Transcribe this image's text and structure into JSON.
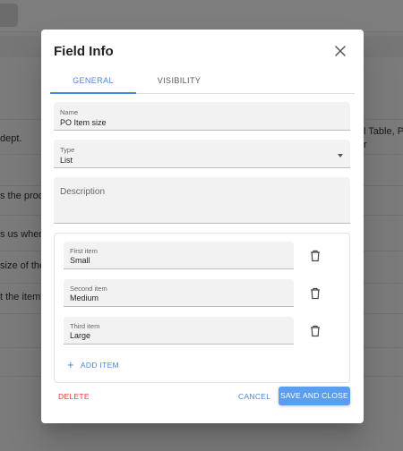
{
  "background": {
    "rows": [
      "dept.",
      "s the produ",
      "s us when",
      "size of the",
      "t the item'"
    ],
    "right_text_line1": "l Table, PO",
    "right_text_line2": "r"
  },
  "dialog": {
    "title": "Field Info",
    "close_icon": "close-icon",
    "tabs": [
      {
        "label": "GENERAL",
        "active": true
      },
      {
        "label": "VISIBILITY",
        "active": false
      }
    ],
    "name_field": {
      "label": "Name",
      "value": "PO Item size"
    },
    "type_field": {
      "label": "Type",
      "value": "List"
    },
    "description_field": {
      "placeholder": "Description"
    },
    "items": [
      {
        "label": "First item",
        "value": "Small"
      },
      {
        "label": "Second item",
        "value": "Medium"
      },
      {
        "label": "Third item",
        "value": "Large"
      }
    ],
    "add_item_label": "ADD ITEM",
    "delete_label": "DELETE",
    "cancel_label": "CANCEL",
    "save_label": "SAVE AND CLOSE"
  },
  "colors": {
    "accent": "#4a86d9",
    "primary_button": "#5b9ef0",
    "danger": "#e53935",
    "overlay": "rgba(0,0,0,0.5)"
  }
}
